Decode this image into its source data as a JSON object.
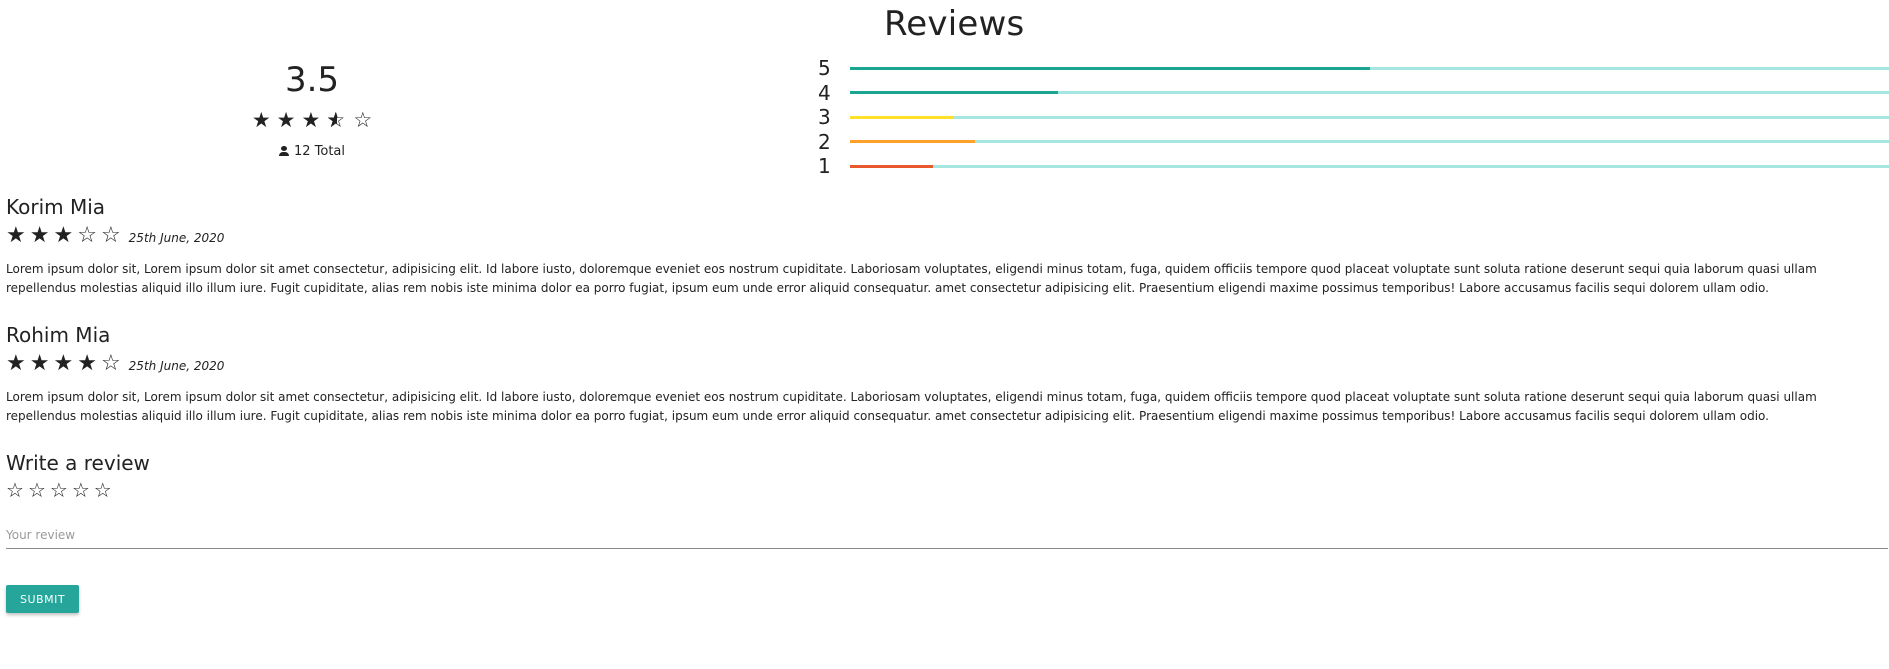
{
  "header": {
    "title": "Reviews"
  },
  "summary": {
    "average": "3.5",
    "average_value": 3.5,
    "total_label": "12 Total"
  },
  "distribution": [
    {
      "label": "5",
      "fraction": 0.5,
      "color": "#1aa593"
    },
    {
      "label": "4",
      "fraction": 0.2,
      "color": "#1aa593"
    },
    {
      "label": "3",
      "fraction": 0.1,
      "color": "#ffe029"
    },
    {
      "label": "2",
      "fraction": 0.12,
      "color": "#ffa02d"
    },
    {
      "label": "1",
      "fraction": 0.08,
      "color": "#e8592e"
    }
  ],
  "track_color": "#a6e6e1",
  "reviews": [
    {
      "name": "Korim Mia",
      "rating": 3,
      "date": "25th June, 2020",
      "text": "Lorem ipsum dolor sit, Lorem ipsum dolor sit amet consectetur, adipisicing elit. Id labore iusto, doloremque eveniet eos nostrum cupiditate. Laboriosam voluptates, eligendi minus totam, fuga, quidem officiis tempore quod placeat voluptate sunt soluta ratione deserunt sequi quia laborum quasi ullam repellendus molestias aliquid illo illum iure. Fugit cupiditate, alias rem nobis iste minima dolor ea porro fugiat, ipsum eum unde error aliquid consequatur. amet consectetur adipisicing elit. Praesentium eligendi maxime possimus temporibus! Labore accusamus facilis sequi dolorem ullam odio."
    },
    {
      "name": "Rohim Mia",
      "rating": 4,
      "date": "25th June, 2020",
      "text": "Lorem ipsum dolor sit, Lorem ipsum dolor sit amet consectetur, adipisicing elit. Id labore iusto, doloremque eveniet eos nostrum cupiditate. Laboriosam voluptates, eligendi minus totam, fuga, quidem officiis tempore quod placeat voluptate sunt soluta ratione deserunt sequi quia laborum quasi ullam repellendus molestias aliquid illo illum iure. Fugit cupiditate, alias rem nobis iste minima dolor ea porro fugiat, ipsum eum unde error aliquid consequatur. amet consectetur adipisicing elit. Praesentium eligendi maxime possimus temporibus! Labore accusamus facilis sequi dolorem ullam odio."
    }
  ],
  "write_review": {
    "title": "Write a review",
    "rating": 0,
    "placeholder": "Your review",
    "value": "",
    "submit_label": "SUBMIT",
    "submit_color": "#26a69a"
  },
  "icons": {
    "star_filled": "star-filled-icon",
    "star_empty": "star-outline-icon",
    "star_half": "star-half-icon",
    "user": "person-icon"
  }
}
